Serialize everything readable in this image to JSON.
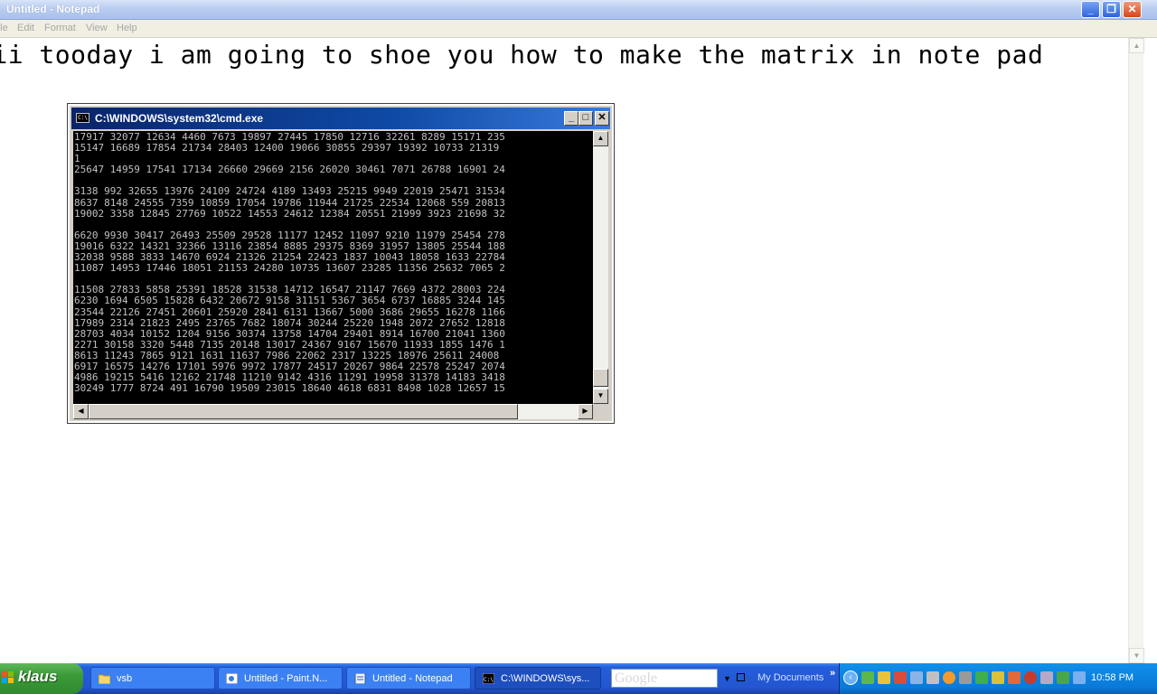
{
  "notepad": {
    "title": "Untitled - Notepad",
    "menu": [
      "File",
      "Edit",
      "Format",
      "View",
      "Help"
    ],
    "content": "hii tooday i am going to shoe you how to make the matrix in note pad"
  },
  "cmd": {
    "title": "C:\\WINDOWS\\system32\\cmd.exe",
    "icon_text": "C:\\",
    "lines": [
      "17917 32077 12634 4460 7673 19897 27445 17850 12716 32261 8289 15171 235",
      "15147 16689 17854 21734 28403 12400 19066 30855 29397 19392 10733 21319",
      "1",
      "25647 14959 17541 17134 26660 29669 2156 26020 30461 7071 26788 16901 24",
      "",
      "3138 992 32655 13976 24109 24724 4189 13493 25215 9949 22019 25471 31534",
      "8637 8148 24555 7359 10859 17054 19786 11944 21725 22534 12068 559 20813",
      "19002 3358 12845 27769 10522 14553 24612 12384 20551 21999 3923 21698 32",
      "",
      "6620 9930 30417 26493 25509 29528 11177 12452 11097 9210 11979 25454 278",
      "19016 6322 14321 32366 13116 23854 8885 29375 8369 31957 13805 25544 188",
      "32038 9588 3833 14670 6924 21326 21254 22423 1837 10043 18058 1633 22784",
      "11087 14953 17446 18051 21153 24280 10735 13607 23285 11356 25632 7065 2",
      "",
      "11508 27833 5858 25391 18528 31538 14712 16547 21147 7669 4372 28003 224",
      "6230 1694 6505 15828 6432 20672 9158 31151 5367 3654 6737 16885 3244 145",
      "23544 22126 27451 20601 25920 2841 6131 13667 5000 3686 29655 16278 1166",
      "17989 2314 21823 2495 23765 7682 18074 30244 25220 1948 2072 27652 12818",
      "28703 4034 10152 1204 9156 30374 13758 14704 29401 8914 16700 21041 1360",
      "2271 30158 3320 5448 7135 20148 13017 24367 9167 15670 11933 1855 1476 1",
      "8613 11243 7865 9121 1631 11637 7986 22062 2317 13225 18976 25611 24008",
      "6917 16575 14276 17101 5976 9972 17877 24517 20267 9864 22578 25247 2074",
      "4986 19215 5416 12162 21748 11210 9142 4316 11291 19958 31378 14183 3418",
      "30249 1777 8724 491 16790 19509 23015 18640 4618 6831 8498 1028 12657 15"
    ]
  },
  "taskbar": {
    "start_label": "klaus",
    "buttons": [
      {
        "label": "vsb",
        "icon": "folder-icon"
      },
      {
        "label": "Untitled - Paint.N...",
        "icon": "paint-icon"
      },
      {
        "label": "Untitled - Notepad",
        "icon": "notepad-icon"
      },
      {
        "label": "C:\\WINDOWS\\sys...",
        "icon": "cmd-icon",
        "active": true
      }
    ],
    "search_placeholder": "Google",
    "toolbar_label": "My Documents",
    "clock": "10:58 PM"
  },
  "colors": {
    "taskbar_blue": "#245edb",
    "start_green": "#3c9a39",
    "console_bg": "#000000",
    "console_text": "#c0c0c0"
  }
}
